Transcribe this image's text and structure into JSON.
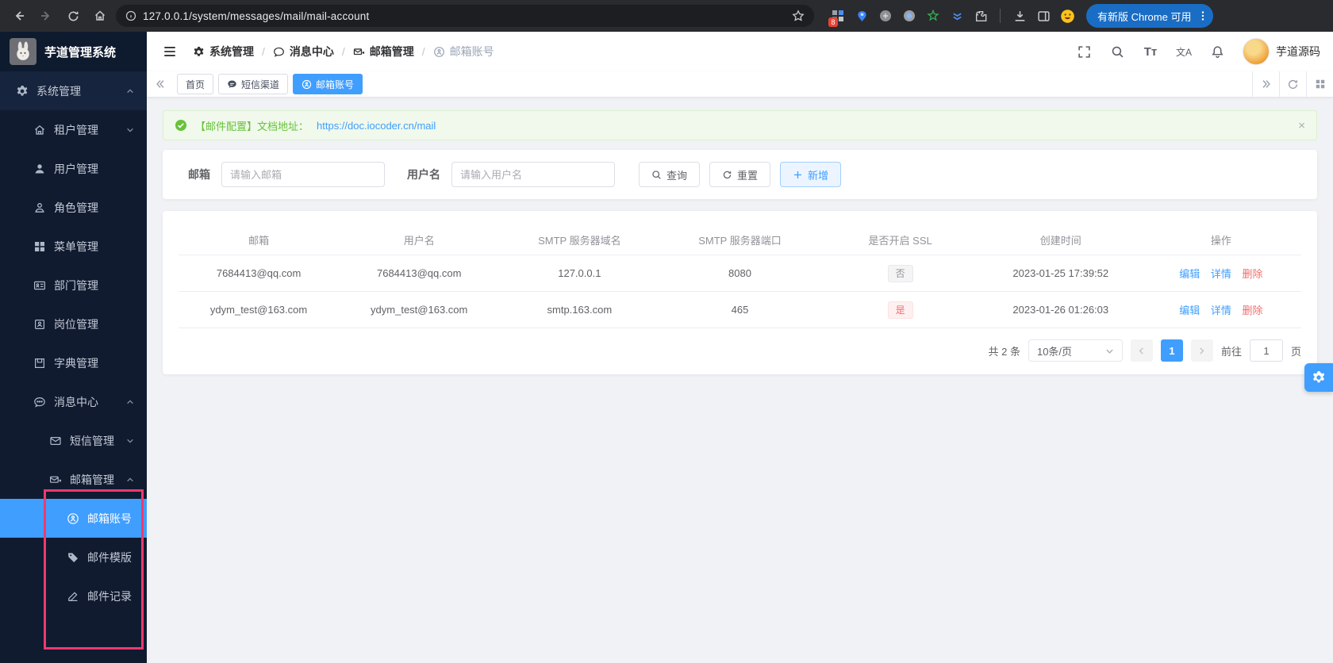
{
  "browser": {
    "url": "127.0.0.1/system/messages/mail/mail-account",
    "update_button": "有新版 Chrome 可用",
    "extension_badge": "8"
  },
  "sidebar": {
    "app_title": "芋道管理系统",
    "items": [
      {
        "label": "系统管理"
      },
      {
        "label": "租户管理"
      },
      {
        "label": "用户管理"
      },
      {
        "label": "角色管理"
      },
      {
        "label": "菜单管理"
      },
      {
        "label": "部门管理"
      },
      {
        "label": "岗位管理"
      },
      {
        "label": "字典管理"
      },
      {
        "label": "消息中心"
      },
      {
        "label": "短信管理"
      },
      {
        "label": "邮箱管理"
      },
      {
        "label": "邮箱账号"
      },
      {
        "label": "邮件模版"
      },
      {
        "label": "邮件记录"
      }
    ]
  },
  "navbar": {
    "breadcrumb": [
      "系统管理",
      "消息中心",
      "邮箱管理",
      "邮箱账号"
    ],
    "separator": "/",
    "font_icon_text": "Tт",
    "lang_icon_text": "文A",
    "username": "芋道源码"
  },
  "tabs": [
    {
      "label": "首页"
    },
    {
      "label": "短信渠道"
    },
    {
      "label": "邮箱账号"
    }
  ],
  "alert": {
    "text": "【邮件配置】文档地址：",
    "link": "https://doc.iocoder.cn/mail",
    "close": "×"
  },
  "search": {
    "email_label": "邮箱",
    "email_placeholder": "请输入邮箱",
    "username_label": "用户名",
    "username_placeholder": "请输入用户名",
    "query_button": "查询",
    "reset_button": "重置",
    "add_button": "新增"
  },
  "table": {
    "headers": [
      "邮箱",
      "用户名",
      "SMTP 服务器域名",
      "SMTP 服务器端口",
      "是否开启 SSL",
      "创建时间",
      "操作"
    ],
    "rows": [
      {
        "email": "7684413@qq.com",
        "username": "7684413@qq.com",
        "domain": "127.0.0.1",
        "port": "8080",
        "ssl": "否",
        "created": "2023-01-25 17:39:52"
      },
      {
        "email": "ydym_test@163.com",
        "username": "ydym_test@163.com",
        "domain": "smtp.163.com",
        "port": "465",
        "ssl": "是",
        "created": "2023-01-26 01:26:03"
      }
    ],
    "actions": {
      "edit": "编辑",
      "detail": "详情",
      "delete": "删除"
    }
  },
  "pagination": {
    "total": "共 2 条",
    "page_size": "10条/页",
    "current_page": "1",
    "goto_label": "前往",
    "goto_value": "1",
    "page_unit": "页"
  },
  "colors": {
    "accent": "#409eff",
    "success": "#67c23a",
    "danger": "#f56c6c",
    "annotation_pink": "#f5386d",
    "sidebar_bg": "#17243d",
    "sidebar_sub_bg": "#101b30",
    "chrome_bg": "#2a2b2e"
  }
}
